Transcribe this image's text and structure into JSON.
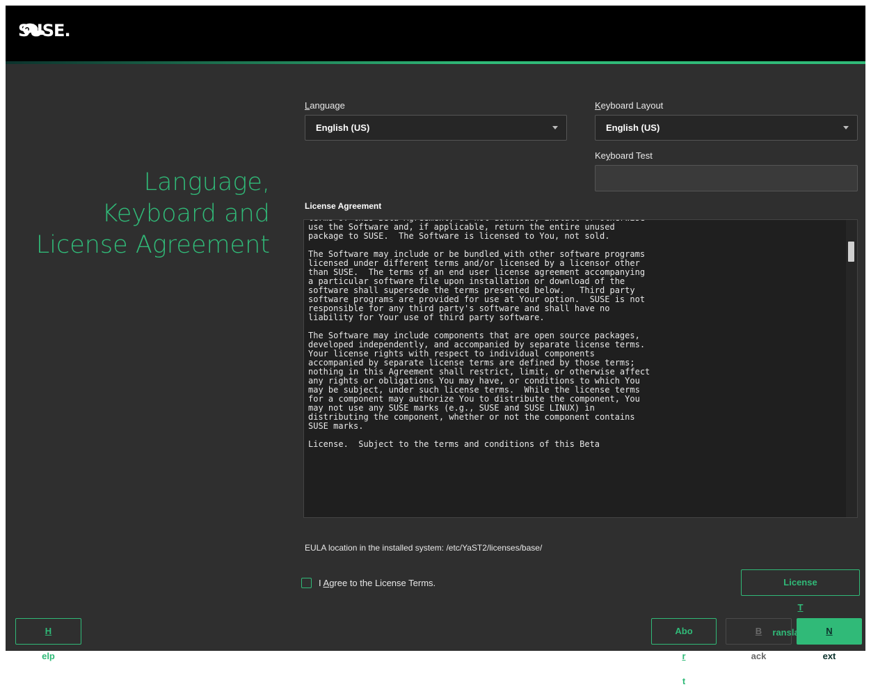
{
  "header": {
    "logo_text": "SUSE."
  },
  "title": {
    "line1": "Language,",
    "line2": "Keyboard and",
    "line3": "License Agreement"
  },
  "language": {
    "label_prefix": "",
    "label_underlined": "L",
    "label_rest": "anguage",
    "value": "English (US)"
  },
  "keyboard": {
    "label_prefix": "",
    "label_underlined": "K",
    "label_rest": "eyboard Layout",
    "value": "English (US)"
  },
  "keyboard_test": {
    "label_prefix": "Ke",
    "label_underlined": "y",
    "label_rest": "board Test",
    "value": ""
  },
  "license": {
    "label": "License Agreement",
    "text": "terms of this Beta Agreement, do not download, install or otherwise\nuse the Software and, if applicable, return the entire unused\npackage to SUSE.  The Software is licensed to You, not sold.\n\nThe Software may include or be bundled with other software programs\nlicensed under different terms and/or licensed by a licensor other\nthan SUSE.  The terms of an end user license agreement accompanying\na particular software file upon installation or download of the\nsoftware shall supersede the terms presented below.   Third party\nsoftware programs are provided for use at Your option.  SUSE is not\nresponsible for any third party's software and shall have no\nliability for Your use of third party software.\n\nThe Software may include components that are open source packages,\ndeveloped independently, and accompanied by separate license terms.\nYour license rights with respect to individual components\naccompanied by separate license terms are defined by those terms;\nnothing in this Agreement shall restrict, limit, or otherwise affect\nany rights or obligations You may have, or conditions to which You\nmay be subject, under such license terms.  While the license terms\nfor a component may authorize You to distribute the component, You\nmay not use any SUSE marks (e.g., SUSE and SUSE LINUX) in\ndistributing the component, whether or not the component contains\nSUSE marks.\n\nLicense.  Subject to the terms and conditions of this Beta"
  },
  "eula_location": "EULA location in the installed system: /etc/YaST2/licenses/base/",
  "agree": {
    "label_prefix": "I ",
    "label_underlined": "A",
    "label_rest": "gree to the License Terms.",
    "checked": false
  },
  "buttons": {
    "license_translations": {
      "prefix": "License ",
      "underlined": "T",
      "rest": "ranslations..."
    },
    "help": {
      "prefix": "",
      "underlined": "H",
      "rest": "elp"
    },
    "abort": {
      "prefix": "Abo",
      "underlined": "r",
      "rest": "t"
    },
    "back": {
      "prefix": "",
      "underlined": "B",
      "rest": "ack"
    },
    "next": {
      "prefix": "",
      "underlined": "N",
      "rest": "ext"
    }
  },
  "colors": {
    "accent": "#30ba78",
    "background": "#2f2f2f",
    "header": "#000000"
  },
  "icons": [
    "chameleon-logo-icon",
    "dropdown-arrow-icon",
    "checkbox-icon"
  ]
}
